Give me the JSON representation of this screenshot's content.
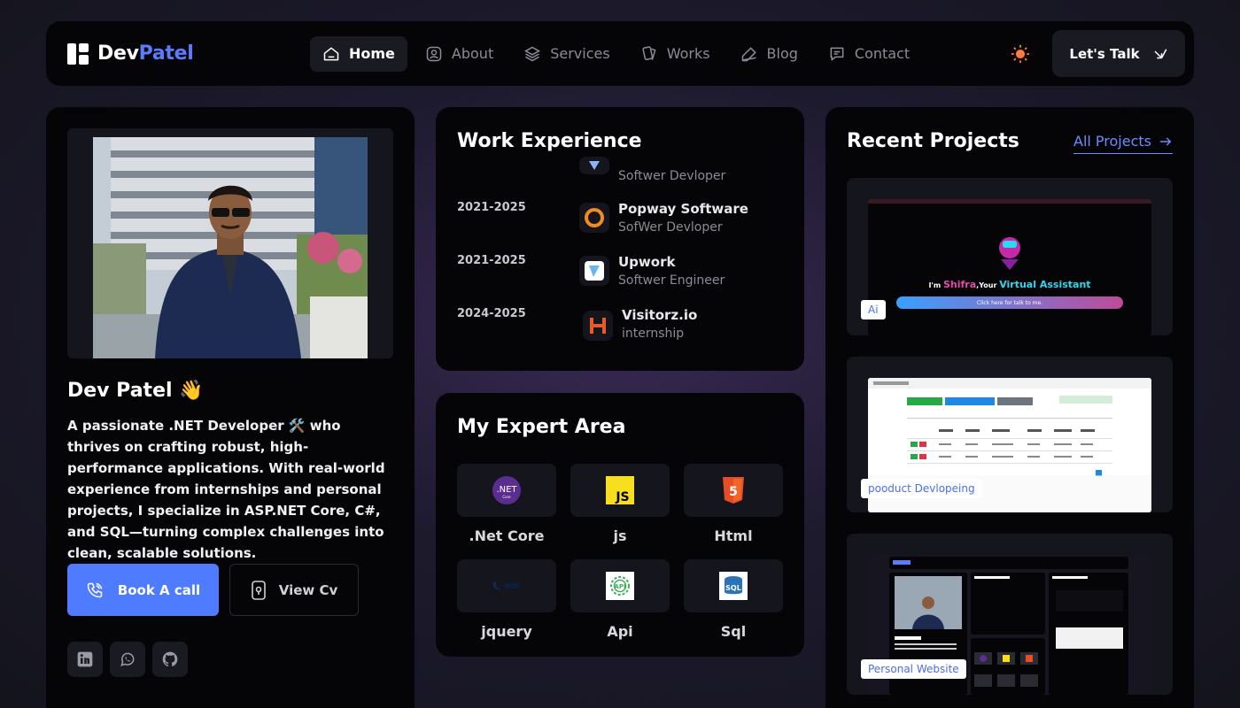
{
  "brand": {
    "first": "Dev",
    "second": "Patel"
  },
  "nav": [
    {
      "label": "Home",
      "icon": "home-icon",
      "active": true
    },
    {
      "label": "About",
      "icon": "user-icon"
    },
    {
      "label": "Services",
      "icon": "layers-icon"
    },
    {
      "label": "Works",
      "icon": "cards-icon"
    },
    {
      "label": "Blog",
      "icon": "pen-icon"
    },
    {
      "label": "Contact",
      "icon": "chat-icon"
    }
  ],
  "cta": {
    "label": "Let's Talk"
  },
  "profile": {
    "name": "Dev Patel",
    "wave": "👋",
    "bio": "A passionate .NET Developer 🛠️ who thrives on crafting robust, high-performance applications. With real-world experience from internships and personal projects, I specialize in ASP.NET Core, C#, and SQL—turning complex challenges into clean, scalable solutions.",
    "book_label": "Book A call",
    "cv_label": "View Cv",
    "socials": [
      "linkedin-icon",
      "whatsapp-icon",
      "github-icon"
    ]
  },
  "work": {
    "title": "Work Experience",
    "partial_role": "Softwer Devloper",
    "items": [
      {
        "years": "2021-2025",
        "company": "Popway Software",
        "role": "SofWer Devloper"
      },
      {
        "years": "2021-2025",
        "company": "Upwork",
        "role": "Softwer Engineer"
      },
      {
        "years": "2024-2025",
        "company": "Visitorz.io",
        "role": "internship"
      }
    ]
  },
  "expert": {
    "title": "My Expert Area",
    "skills": [
      {
        "label": ".Net Core",
        "icon": "dotnet-icon"
      },
      {
        "label": "js",
        "icon": "javascript-icon"
      },
      {
        "label": "Html",
        "icon": "html5-icon"
      },
      {
        "label": "jquery",
        "icon": "jquery-icon"
      },
      {
        "label": "Api",
        "icon": "api-icon"
      },
      {
        "label": "Sql",
        "icon": "sql-icon"
      }
    ]
  },
  "projects": {
    "title": "Recent Projects",
    "all_label": "All Projects",
    "items": [
      {
        "tag": "Ai",
        "prefix": "I'm ",
        "highlight": "Shifra",
        "mid": ",Your ",
        "assistant": "Virtual Assistant",
        "bar": "Click here for talk to me."
      },
      {
        "tag": "pooduct Devlopeing"
      },
      {
        "tag": "Personal Website"
      }
    ]
  },
  "colors": {
    "accent": "#4f7cff",
    "brand_blue": "#5b7cff",
    "card": "#050507",
    "tile": "#15161d"
  }
}
